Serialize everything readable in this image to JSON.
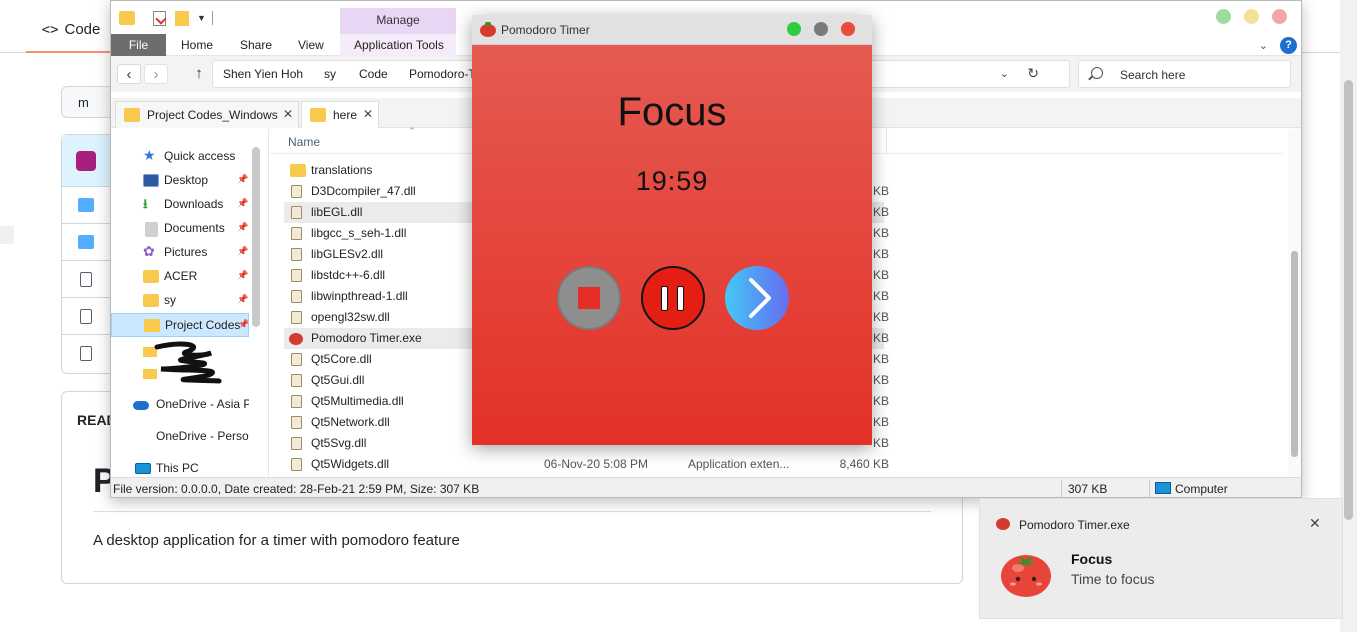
{
  "github": {
    "code_tab_icon": "<>",
    "code_tab": "Code",
    "branch_fragment": "m",
    "readme_label": "READ",
    "readme_heading_fragment": "P",
    "readme_description": "A desktop application for a timer with pomodoro feature"
  },
  "explorer": {
    "manage_tab": "Manage",
    "ribbon_tabs": [
      "File",
      "Home",
      "Share",
      "View",
      "Application Tools"
    ],
    "breadcrumbs": [
      "Shen Yien Hoh",
      "sy",
      "Code",
      "Pomodoro-T"
    ],
    "search_placeholder": "Search here",
    "tabs": [
      "Project Codes_Windows",
      "here"
    ],
    "sidebar": {
      "quick_access": "Quick access",
      "items": [
        "Desktop",
        "Downloads",
        "Documents",
        "Pictures",
        "ACER",
        "sy",
        "Project Codes"
      ],
      "onedrive_1": "OneDrive - Asia Pa",
      "onedrive_2": "OneDrive - Person",
      "this_pc": "This PC"
    },
    "column_name": "Name",
    "files": [
      {
        "name": "translations",
        "date": "",
        "type": "",
        "size": ""
      },
      {
        "name": "D3Dcompiler_47.dll",
        "date": "",
        "type": "",
        "size": "KB"
      },
      {
        "name": "libEGL.dll",
        "date": "",
        "type": "",
        "size": "KB"
      },
      {
        "name": "libgcc_s_seh-1.dll",
        "date": "",
        "type": "",
        "size": "KB"
      },
      {
        "name": "libGLESv2.dll",
        "date": "",
        "type": "",
        "size": "KB"
      },
      {
        "name": "libstdc++-6.dll",
        "date": "",
        "type": "",
        "size": "KB"
      },
      {
        "name": "libwinpthread-1.dll",
        "date": "",
        "type": "",
        "size": "KB"
      },
      {
        "name": "opengl32sw.dll",
        "date": "",
        "type": "",
        "size": "KB"
      },
      {
        "name": "Pomodoro Timer.exe",
        "date": "",
        "type": "",
        "size": "KB"
      },
      {
        "name": "Qt5Core.dll",
        "date": "",
        "type": "",
        "size": "KB"
      },
      {
        "name": "Qt5Gui.dll",
        "date": "",
        "type": "",
        "size": "KB"
      },
      {
        "name": "Qt5Multimedia.dll",
        "date": "",
        "type": "",
        "size": "KB"
      },
      {
        "name": "Qt5Network.dll",
        "date": "",
        "type": "",
        "size": "KB"
      },
      {
        "name": "Qt5Svg.dll",
        "date": "",
        "type": "",
        "size": "KB"
      },
      {
        "name": "Qt5Widgets.dll",
        "date": "06-Nov-20 5:08 PM",
        "type": "Application exten...",
        "size": "8,460 KB"
      }
    ],
    "status": {
      "info": "File version: 0.0.0.0, Date created: 28-Feb-21 2:59 PM, Size: 307 KB",
      "size": "307 KB",
      "location": "Computer"
    }
  },
  "pomodoro": {
    "title": "Pomodoro Timer",
    "mode": "Focus",
    "time": "19:59"
  },
  "toast": {
    "app": "Pomodoro Timer.exe",
    "title": "Focus",
    "body": "Time to focus"
  },
  "colors": {
    "pomodoro_red": "#e33127",
    "light_green": "#2ecc40",
    "light_gray": "#7a7a7a",
    "light_red": "#e74c3c",
    "ribbon_file_tab": "#6d6d6d",
    "manage_tab": "#e9d5f4"
  },
  "icons": [
    "folder-icon",
    "tomato-icon",
    "search-icon",
    "close-icon",
    "pin-icon",
    "star-icon",
    "help-icon",
    "stop-icon",
    "pause-icon",
    "next-icon"
  ]
}
